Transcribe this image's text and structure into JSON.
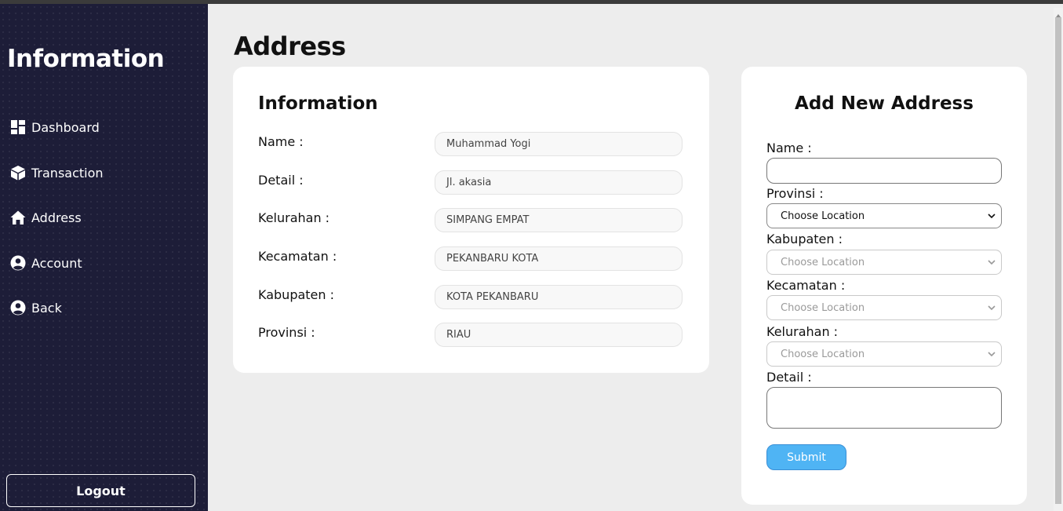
{
  "sidebar": {
    "brand": "Information",
    "items": [
      {
        "label": "Dashboard",
        "icon": "dashboard-icon"
      },
      {
        "label": "Transaction",
        "icon": "box-icon"
      },
      {
        "label": "Address",
        "icon": "home-icon"
      },
      {
        "label": "Account",
        "icon": "user-circle-icon"
      },
      {
        "label": "Back",
        "icon": "user-circle-icon"
      }
    ],
    "logout_label": "Logout"
  },
  "page": {
    "title": "Address"
  },
  "info_card": {
    "title": "Information",
    "fields": [
      {
        "label": "Name :",
        "value": "Muhammad Yogi"
      },
      {
        "label": "Detail :",
        "value": "Jl. akasia"
      },
      {
        "label": "Kelurahan :",
        "value": "SIMPANG EMPAT"
      },
      {
        "label": "Kecamatan :",
        "value": "PEKANBARU KOTA"
      },
      {
        "label": "Kabupaten :",
        "value": "KOTA PEKANBARU"
      },
      {
        "label": "Provinsi :",
        "value": "RIAU"
      }
    ]
  },
  "add_form": {
    "title": "Add New Address",
    "name_label": "Name :",
    "name_value": "",
    "provinsi_label": "Provinsi :",
    "provinsi_value": "Choose Location",
    "kabupaten_label": "Kabupaten :",
    "kabupaten_value": "Choose Location",
    "kecamatan_label": "Kecamatan :",
    "kecamatan_value": "Choose Location",
    "kelurahan_label": "Kelurahan :",
    "kelurahan_value": "Choose Location",
    "detail_label": "Detail :",
    "detail_value": "",
    "submit_label": "Submit"
  },
  "colors": {
    "sidebar_bg": "#1d1d38",
    "page_bg": "#ededed",
    "submit_bg": "#4fb4f4"
  }
}
